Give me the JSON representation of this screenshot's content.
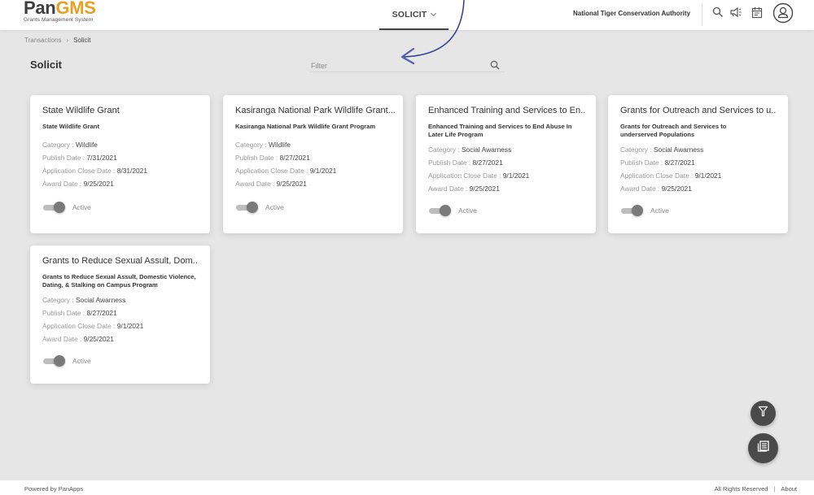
{
  "header": {
    "logo_pan": "Pan",
    "logo_gms": "GMS",
    "logo_subtitle": "Grants Management System",
    "nav_tab": "SOLICIT",
    "org_name": "National Tiger Conservation Authority",
    "icons": [
      "search-icon",
      "megaphone-icon",
      "calendar-icon",
      "user-avatar-icon"
    ]
  },
  "breadcrumb": {
    "parent": "Transactions",
    "separator": "›",
    "current": "Solicit"
  },
  "page": {
    "title": "Solicit",
    "filter_placeholder": "Filter",
    "filter_value": ""
  },
  "labels": {
    "category": "Category : ",
    "publish_date": "Publish Date : ",
    "close_date": "Application Close Date : ",
    "award_date": "Award Date : "
  },
  "cards": [
    {
      "title": "State Wildlife Grant",
      "description": "State Wildlife Grant",
      "category": "Wildlife",
      "publish_date": "7/31/2021",
      "close_date": "8/31/2021",
      "award_date": "9/25/2021",
      "status": "Active",
      "active": true
    },
    {
      "title": "Kasiranga National Park Wildlife Grant...",
      "description": "Kasiranga National Park Wildlife Grant Program",
      "category": "Wildlife",
      "publish_date": "8/27/2021",
      "close_date": "9/1/2021",
      "award_date": "9/25/2021",
      "status": "Active",
      "active": true
    },
    {
      "title": "Enhanced Training and Services to En..",
      "description": "Enhanced Training and Services to End Abuse In Later Life Program",
      "category": "Social Awarness",
      "publish_date": "8/27/2021",
      "close_date": "9/1/2021",
      "award_date": "9/25/2021",
      "status": "Active",
      "active": true
    },
    {
      "title": "Grants for Outreach and Services to u..",
      "description": "Grants for Outreach and Services to underserved Populations",
      "category": "Social Awarness",
      "publish_date": "8/27/2021",
      "close_date": "9/1/2021",
      "award_date": "9/25/2021",
      "status": "Active",
      "active": true
    },
    {
      "title": "Grants to Reduce Sexual Assult, Dom..",
      "description": "Grants to Reduce Sexual Assult, Domestic Violence, Dating, & Stalking on Campus Program",
      "category": "Social Awarness",
      "publish_date": "8/27/2021",
      "close_date": "9/1/2021",
      "award_date": "9/25/2021",
      "status": "Active",
      "active": true
    }
  ],
  "fabs": [
    "filter-icon",
    "list-view-icon"
  ],
  "footer": {
    "powered_by": "Powered by PanApps",
    "rights": "All Rights Reserved",
    "separator": "|",
    "about": "About"
  },
  "colors": {
    "brand_orange": "#e8a020",
    "brand_dark": "#3d3d3d",
    "annotation_arrow": "#2e3a8c"
  }
}
